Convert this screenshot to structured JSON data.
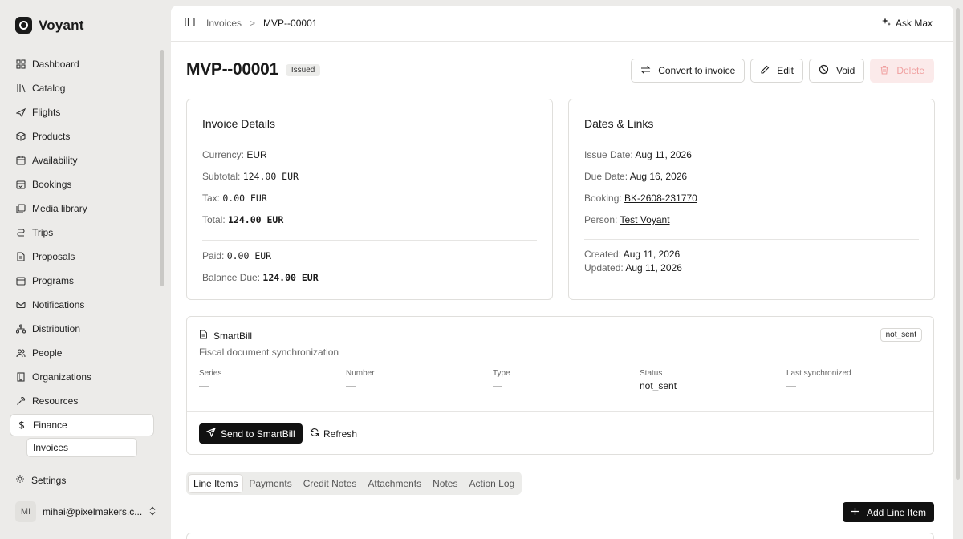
{
  "brand": {
    "name": "Voyant"
  },
  "sidebar": {
    "items": [
      {
        "label": "Dashboard",
        "icon": "dashboard-icon"
      },
      {
        "label": "Catalog",
        "icon": "library-icon"
      },
      {
        "label": "Flights",
        "icon": "plane-icon"
      },
      {
        "label": "Products",
        "icon": "package-icon"
      },
      {
        "label": "Availability",
        "icon": "calendar-grid-icon"
      },
      {
        "label": "Bookings",
        "icon": "calendar-check-icon"
      },
      {
        "label": "Media library",
        "icon": "image-stack-icon"
      },
      {
        "label": "Trips",
        "icon": "route-icon"
      },
      {
        "label": "Proposals",
        "icon": "file-text-icon"
      },
      {
        "label": "Programs",
        "icon": "calendar-range-icon"
      },
      {
        "label": "Notifications",
        "icon": "mail-icon"
      },
      {
        "label": "Distribution",
        "icon": "network-icon"
      },
      {
        "label": "People",
        "icon": "users-icon"
      },
      {
        "label": "Organizations",
        "icon": "building-icon"
      },
      {
        "label": "Resources",
        "icon": "wrench-icon"
      },
      {
        "label": "Finance",
        "icon": "dollar-icon"
      }
    ],
    "sub_active": "Invoices",
    "settings": "Settings",
    "account": {
      "initials": "MI",
      "email": "mihai@pixelmakers.c..."
    }
  },
  "breadcrumb": {
    "parent": "Invoices",
    "separator": ">",
    "current": "MVP--00001"
  },
  "ask_max": "Ask Max",
  "header": {
    "title": "MVP--00001",
    "status": "Issued"
  },
  "actions": {
    "convert": "Convert to invoice",
    "edit": "Edit",
    "void": "Void",
    "delete": "Delete"
  },
  "invoice_details": {
    "heading": "Invoice Details",
    "currency_label": "Currency:",
    "currency": "EUR",
    "subtotal_label": "Subtotal:",
    "subtotal": "124.00 EUR",
    "tax_label": "Tax:",
    "tax": "0.00 EUR",
    "total_label": "Total:",
    "total": "124.00 EUR",
    "paid_label": "Paid:",
    "paid": "0.00 EUR",
    "balance_label": "Balance Due:",
    "balance": "124.00 EUR"
  },
  "dates_links": {
    "heading": "Dates & Links",
    "issue_label": "Issue Date:",
    "issue": "Aug 11, 2026",
    "due_label": "Due Date:",
    "due": "Aug 16, 2026",
    "booking_label": "Booking:",
    "booking": "BK-2608-231770",
    "person_label": "Person:",
    "person": "Test Voyant",
    "created_label": "Created:",
    "created": "Aug 11, 2026",
    "updated_label": "Updated:",
    "updated": "Aug 11, 2026"
  },
  "smartbill": {
    "title": "SmartBill",
    "subtitle": "Fiscal document synchronization",
    "badge": "not_sent",
    "columns": [
      {
        "label": "Series",
        "value": "—"
      },
      {
        "label": "Number",
        "value": "—"
      },
      {
        "label": "Type",
        "value": "—"
      },
      {
        "label": "Status",
        "value": "not_sent"
      },
      {
        "label": "Last synchronized",
        "value": "—"
      }
    ],
    "send": "Send to SmartBill",
    "refresh": "Refresh"
  },
  "tabs": [
    "Line Items",
    "Payments",
    "Credit Notes",
    "Attachments",
    "Notes",
    "Action Log"
  ],
  "add_line_item": "Add Line Item"
}
